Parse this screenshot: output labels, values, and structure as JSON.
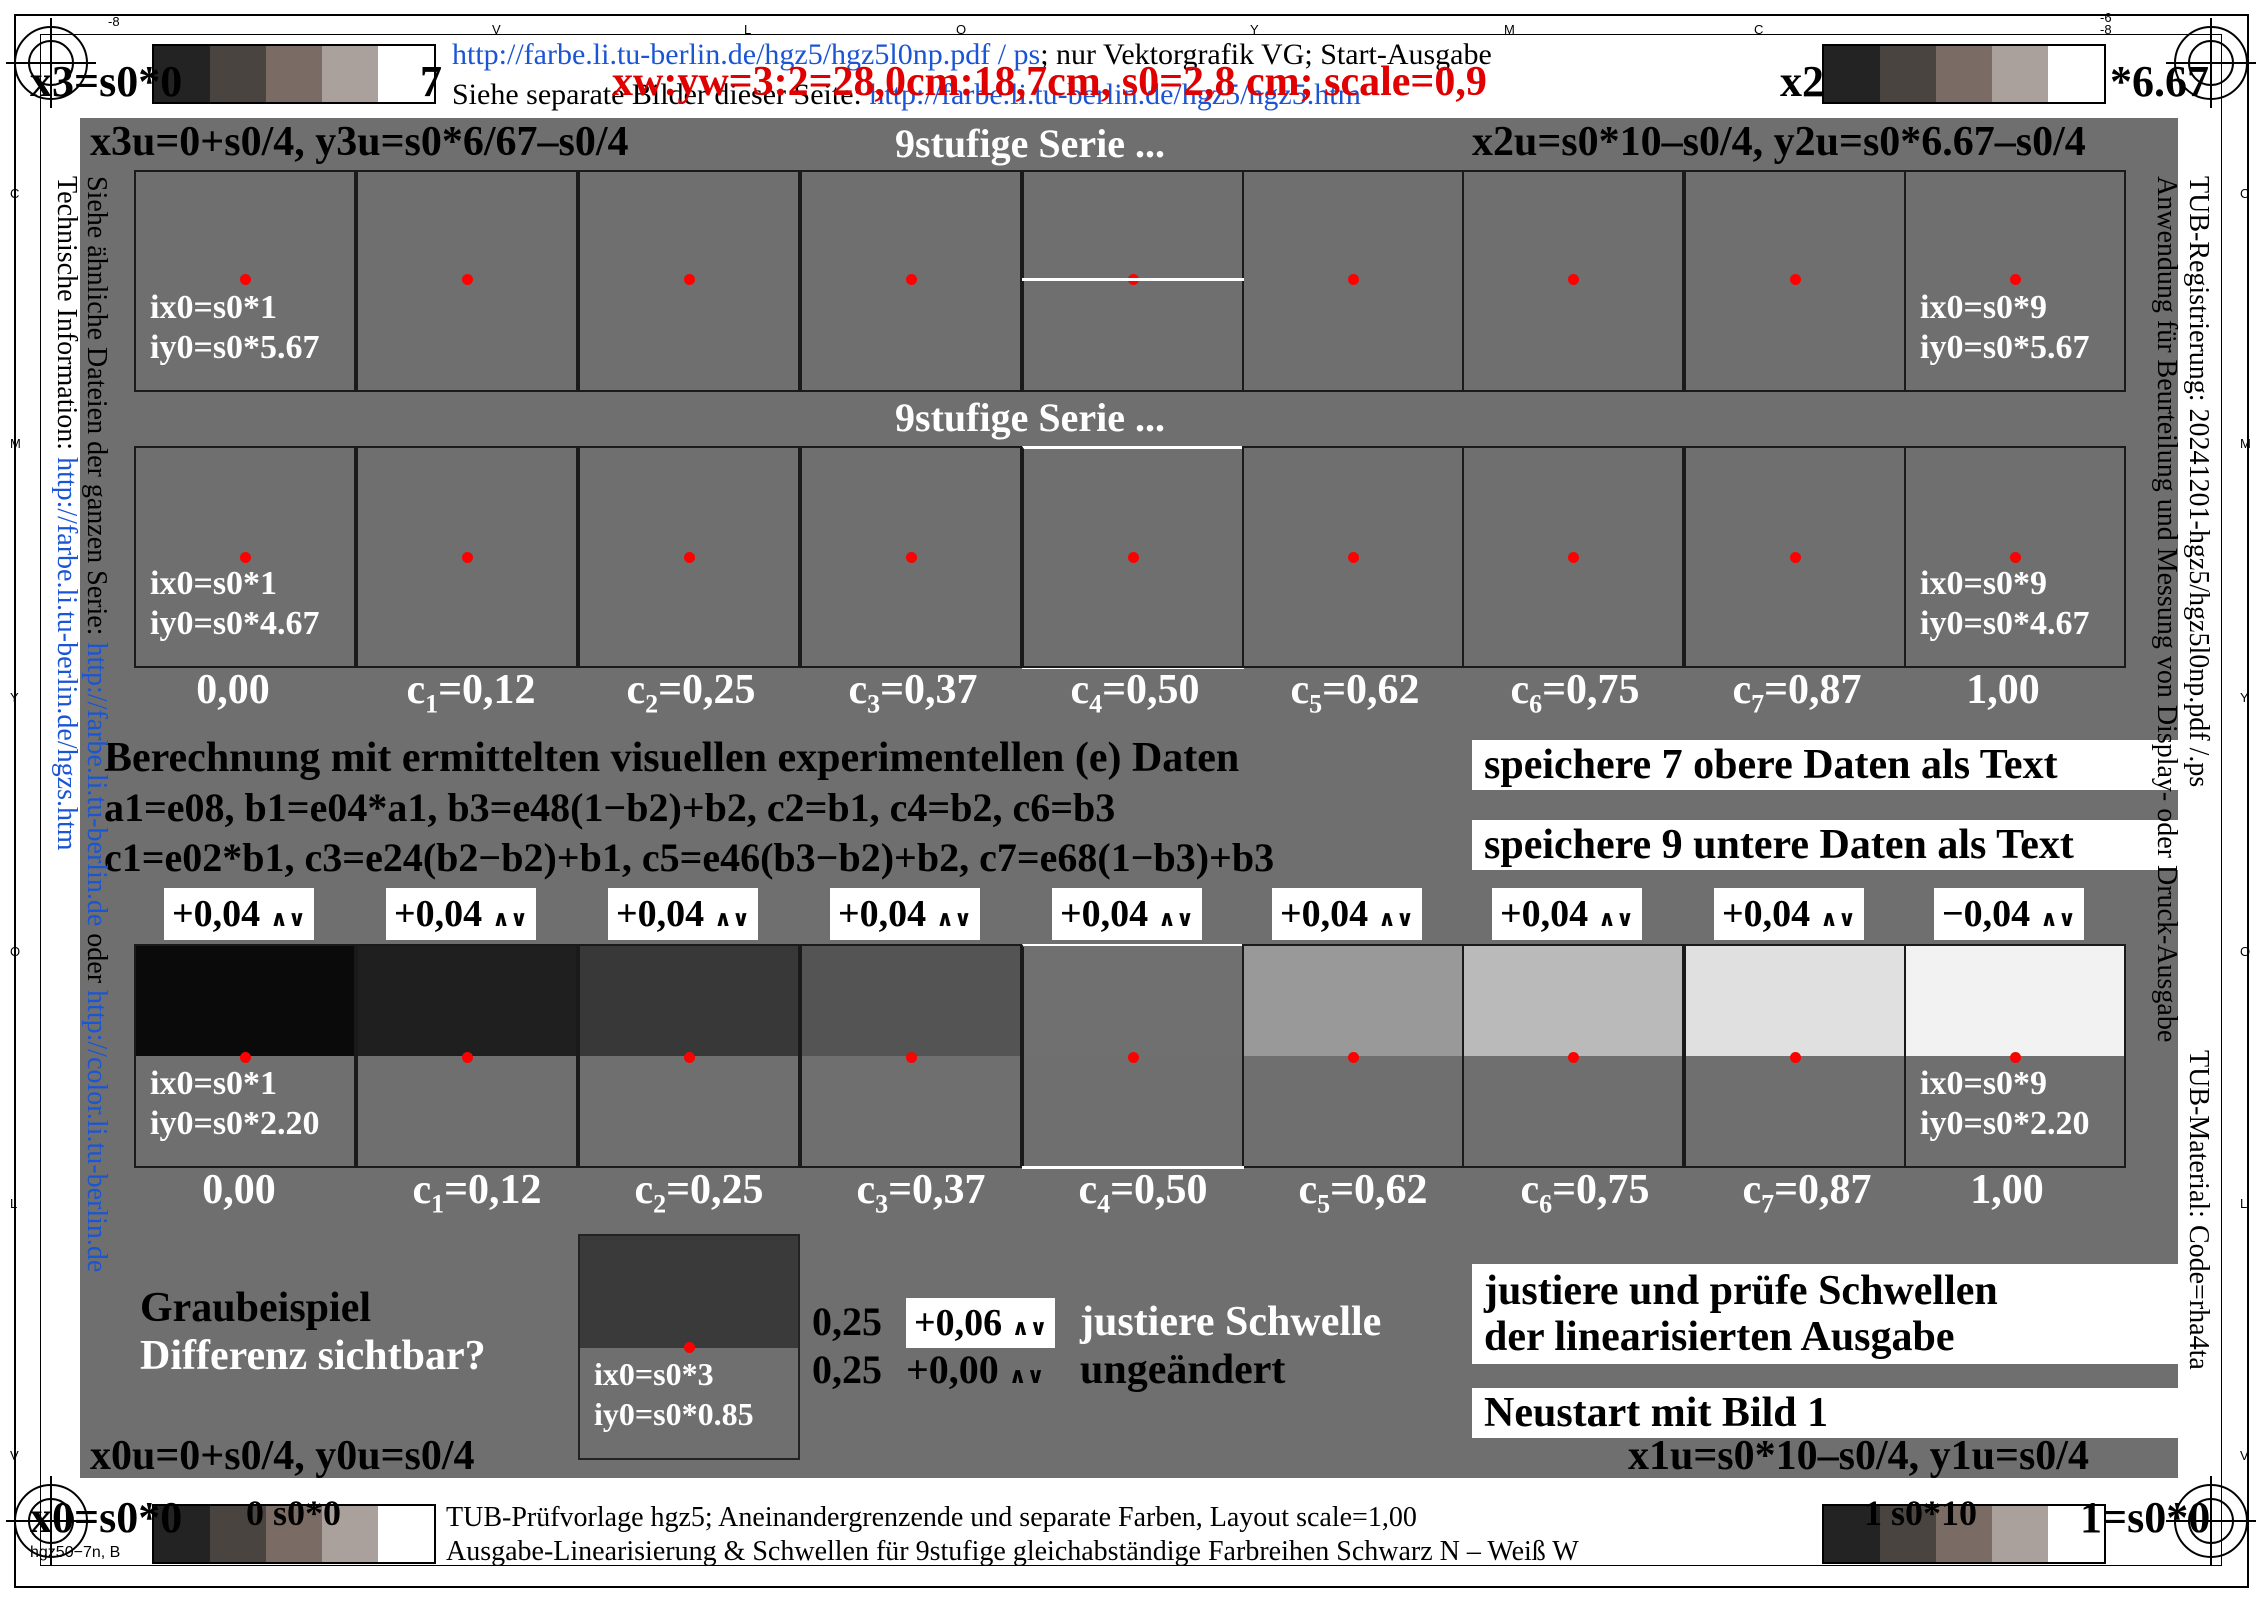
{
  "top": {
    "link": "http://farbe.li.tu-berlin.de/hgz5/hgz5l0np.pdf / ps",
    "link_suffix": "; nur Vektorgrafik VG; Start-Ausgabe",
    "line2_prefix": "Siehe separate Bilder dieser Seite:",
    "line2_link": "http://farbe.li.tu-berlin.de/hgz5/hgz5.htm",
    "title_red": "xw:yw=3:2=28,0cm:18,7cm, s0=2,8 cm; scale=0,9",
    "corner_left": "x3=s0*0",
    "corner_left_suffix": "7",
    "corner_right": "x2",
    "corner_right_suffix": "*6.67"
  },
  "header": {
    "left": "x3u=0+s0/4, y3u=s0*6/67–s0/4",
    "center": "9stufige Serie ...",
    "right": "x2u=s0*10–s0/4, y2u=s0*6.67–s0/4",
    "center2": "9stufige Serie ..."
  },
  "row1": {
    "left_l1": "ix0=s0*1",
    "left_l2": "iy0=s0*5.67",
    "right_l1": "ix0=s0*9",
    "right_l2": "iy0=s0*5.67"
  },
  "row2": {
    "left_l1": "ix0=s0*1",
    "left_l2": "iy0=s0*4.67",
    "right_l1": "ix0=s0*9",
    "right_l2": "iy0=s0*4.67"
  },
  "values": {
    "v0": "0,00",
    "c1": "c",
    "c1s": "1",
    "c1v": "=0,12",
    "c2": "c",
    "c2s": "2",
    "c2v": "=0,25",
    "c3": "c",
    "c3s": "3",
    "c3v": "=0,37",
    "c4": "c",
    "c4s": "4",
    "c4v": "=0,50",
    "c5": "c",
    "c5s": "5",
    "c5v": "=0,62",
    "c6": "c",
    "c6s": "6",
    "c6v": "=0,75",
    "c7": "c",
    "c7s": "7",
    "c7v": "=0,87",
    "v8": "1,00"
  },
  "calc": {
    "title": "Berechnung mit ermittelten visuellen experimentellen (e) Daten",
    "line1": "a1=e08, b1=e04*a1, b3=e48(1−b2)+b2, c2=b1, c4=b2, c6=b3",
    "line2": "c1=e02*b1, c3=e24(b2−b2)+b1, c5=e46(b3−b2)+b2, c7=e68(1−b3)+b3"
  },
  "buttons": {
    "save7": "speichere 7 obere Daten als Text",
    "save9": "speichere 9 untere Daten als Text",
    "check1": "justiere und prüfe Schwellen",
    "check2": "der linearisierten Ausgabe",
    "restart": "Neustart mit Bild 1"
  },
  "adjust": {
    "p": "+0,04",
    "m": "−0,04",
    "arrows": "∧∨"
  },
  "row3": {
    "left_l1": "ix0=s0*1",
    "left_l2": "iy0=s0*2.20",
    "right_l1": "ix0=s0*9",
    "right_l2": "iy0=s0*2.20"
  },
  "gray_levels": [
    0.04,
    0.12,
    0.22,
    0.33,
    0.44,
    0.6,
    0.73,
    0.88,
    0.95
  ],
  "example": {
    "label1": "Graubeispiel",
    "label2": "Differenz sichtbar?",
    "ix": "ix0=s0*3",
    "iy": "iy0=s0*0.85",
    "r1_base": "0,25",
    "r1_adj": "+0,06",
    "r1_text": "justiere Schwelle",
    "r2_base": "0,25",
    "r2_adj": "+0,00",
    "r2_text": "ungeändert"
  },
  "bottom_header": {
    "left": "x0u=0+s0/4, y0u=s0/4",
    "right": "x1u=s0*10–s0/4, y1u=s0/4",
    "corner_left": "x0=s0*0",
    "corner_left_mid": "0 s0*0",
    "corner_right_mid": "1 s0*10",
    "corner_right": "1=s0*0"
  },
  "footer": {
    "line1": "TUB-Prüfvorlage hgz5; Aneinandergrenzende und separate Farben, Layout scale=1,00",
    "line2": "Ausgabe-Linearisierung & Schwellen für 9stufige gleichabständige Farbreihen Schwarz N – Weiß W",
    "code_left": "hgz50−7n, B"
  },
  "left_vert": {
    "line1": "Siehe ähnliche Dateien der ganzen Serie:",
    "line1_link": "http://farbe.li.tu-berlin.de",
    "line1_or": "oder",
    "line1_link2": "http://color.li.tu-berlin.de",
    "line2": "Technische Information:",
    "line2_link": "http://farbe.li.tu-berlin.de/hgzs.htm"
  },
  "right_vert": {
    "line1": "TUB-Registrierung: 20241201-hgz5/hgz5l0np.pdf /.ps",
    "line2": "Anwendung für Beurteilung und Messung von Display- oder Druck-Ausgabe",
    "line3": "TUB-Material: Code=rha4ta"
  },
  "edge_marks": {
    "top": [
      "-8",
      "V",
      "L",
      "O",
      "Y",
      "M",
      "C",
      "-6",
      "-8"
    ],
    "side": [
      "C",
      "M",
      "Y",
      "O",
      "L",
      "V"
    ]
  },
  "colors": {
    "panel": "#6f6f6f",
    "dot": "#ff0000",
    "title_red": "#e00000",
    "link_blue": "#1a55d6"
  }
}
